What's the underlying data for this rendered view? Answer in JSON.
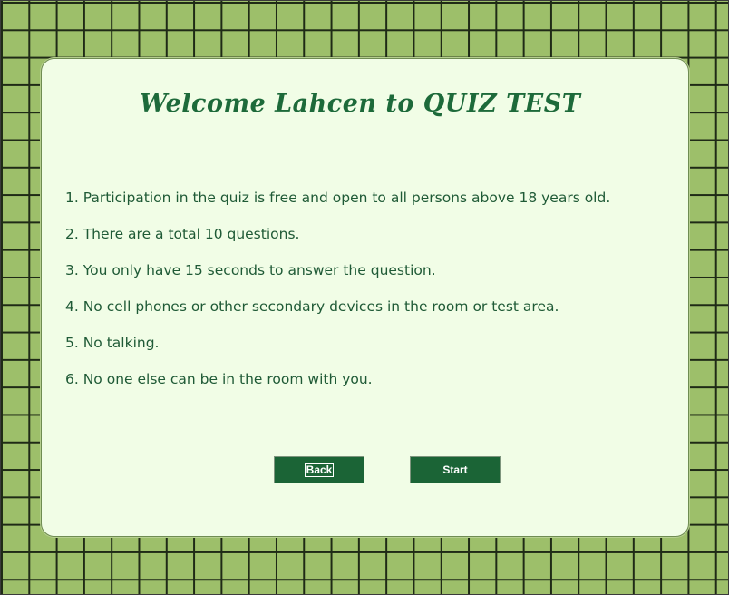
{
  "welcome": {
    "title": "Welcome Lahcen to QUIZ TEST",
    "rules": [
      "1. Participation in the quiz is free and open to all persons above 18 years old.",
      "2. There are a total 10 questions.",
      "3. You only have 15 seconds to answer the question.",
      "4. No cell phones or other secondary devices in the room or test area.",
      "5. No talking.",
      "6. No one else can be in the room with you."
    ]
  },
  "buttons": {
    "back_label": "Back",
    "start_label": "Start"
  },
  "colors": {
    "background_grid": "#9dbf6a",
    "panel": "#f1fde6",
    "title_text": "#1d6a3a",
    "body_text": "#1f5a36",
    "button_fill": "#1b6436"
  }
}
